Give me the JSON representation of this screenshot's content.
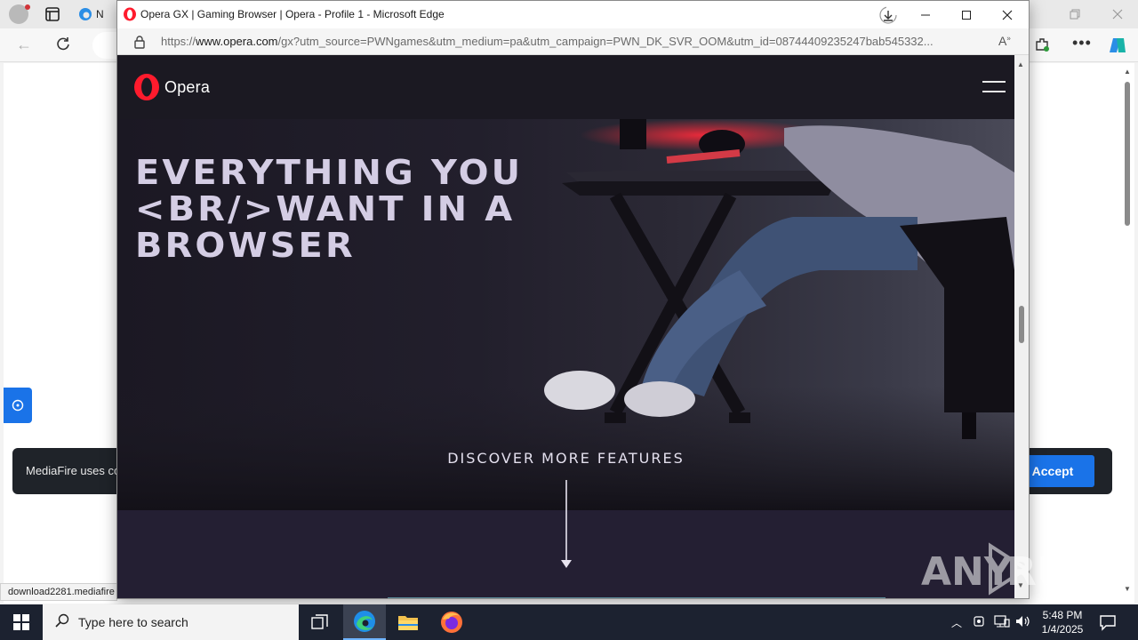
{
  "background_window": {
    "tab_label": "N",
    "cookie_text": "MediaFire uses co",
    "accept_label": "Accept",
    "status_url": "download2281.mediafire"
  },
  "popup": {
    "title": "Opera GX | Gaming Browser | Opera - Profile 1 - Microsoft Edge",
    "url_prefix": "https://",
    "url_host": "www.opera.com",
    "url_rest": "/gx?utm_source=PWNgames&utm_medium=pa&utm_campaign=PWN_DK_SVR_OOM&utm_id=08744409235247bab545332..."
  },
  "opera_page": {
    "logo_text": "Opera",
    "hero_title": "EVERYTHING YOU <BR/>WANT IN A BROWSER",
    "discover": "DISCOVER MORE FEATURES"
  },
  "watermark": "ANY RUN",
  "taskbar": {
    "search_placeholder": "Type here to search",
    "time": "5:48 PM",
    "date": "1/4/2025"
  },
  "colors": {
    "opera_red": "#ff1b2d",
    "accept_blue": "#1a73e8",
    "hero_text": "#d4cde4",
    "taskbar": "#1c2230"
  },
  "icons": [
    "profile-icon",
    "tab-actions-icon",
    "edge-tab-icon",
    "refresh-icon",
    "back-icon",
    "extension-icon",
    "more-icon",
    "copilot-icon",
    "opera-favicon",
    "download-icon",
    "lock-icon",
    "read-aloud-icon",
    "hamburger-icon",
    "arrow-down-icon",
    "windows-start-icon",
    "search-icon",
    "task-view-icon",
    "edge-icon",
    "file-explorer-icon",
    "firefox-icon",
    "network-icon",
    "volume-icon",
    "notification-icon"
  ]
}
